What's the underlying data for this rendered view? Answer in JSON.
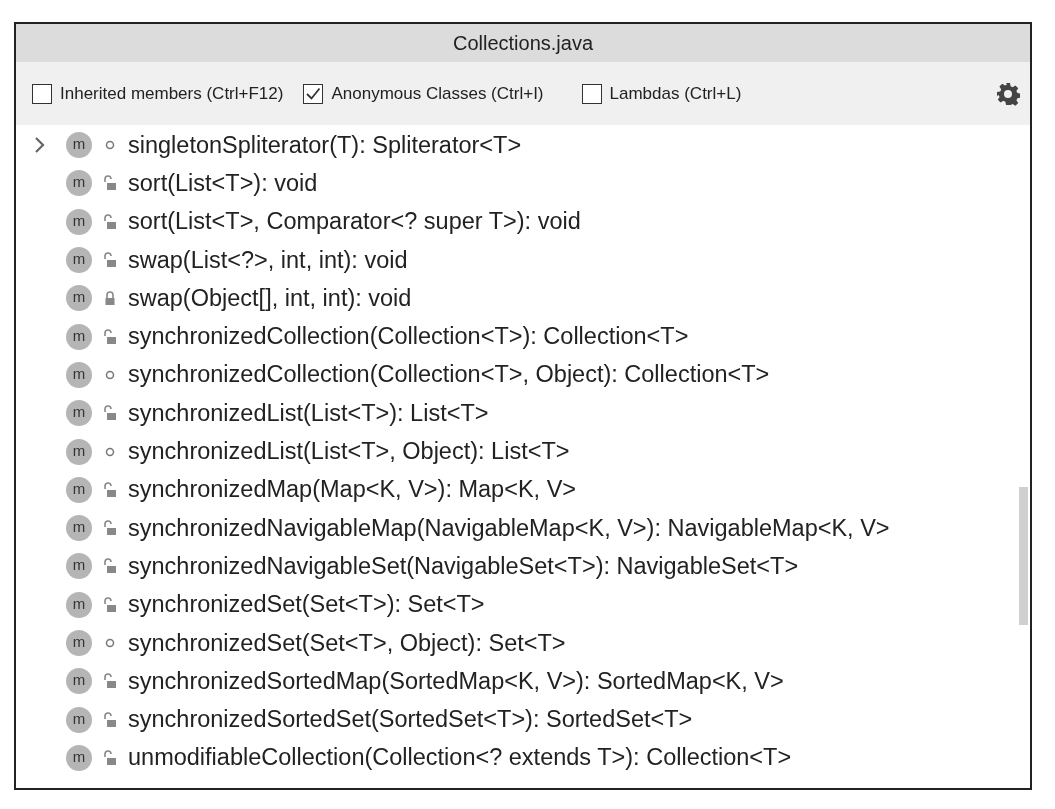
{
  "window": {
    "title": "Collections.java"
  },
  "options": [
    {
      "label": "Inherited members (Ctrl+F12)",
      "checked": false
    },
    {
      "label": "Anonymous Classes (Ctrl+I)",
      "checked": true
    },
    {
      "label": "Lambdas (Ctrl+L)",
      "checked": false
    }
  ],
  "members": [
    {
      "icon": "m",
      "kind": "package",
      "has_children": true,
      "signature": "singletonSpliterator(T): Spliterator<T>"
    },
    {
      "icon": "m",
      "kind": "public",
      "has_children": false,
      "signature": "sort(List<T>): void"
    },
    {
      "icon": "m",
      "kind": "public",
      "has_children": false,
      "signature": "sort(List<T>, Comparator<? super T>): void"
    },
    {
      "icon": "m",
      "kind": "public",
      "has_children": false,
      "signature": "swap(List<?>, int, int): void"
    },
    {
      "icon": "m",
      "kind": "private",
      "has_children": false,
      "signature": "swap(Object[], int, int): void"
    },
    {
      "icon": "m",
      "kind": "public",
      "has_children": false,
      "signature": "synchronizedCollection(Collection<T>): Collection<T>"
    },
    {
      "icon": "m",
      "kind": "package",
      "has_children": false,
      "signature": "synchronizedCollection(Collection<T>, Object): Collection<T>"
    },
    {
      "icon": "m",
      "kind": "public",
      "has_children": false,
      "signature": "synchronizedList(List<T>): List<T>"
    },
    {
      "icon": "m",
      "kind": "package",
      "has_children": false,
      "signature": "synchronizedList(List<T>, Object): List<T>"
    },
    {
      "icon": "m",
      "kind": "public",
      "has_children": false,
      "signature": "synchronizedMap(Map<K, V>): Map<K, V>"
    },
    {
      "icon": "m",
      "kind": "public",
      "has_children": false,
      "signature": "synchronizedNavigableMap(NavigableMap<K, V>): NavigableMap<K, V>"
    },
    {
      "icon": "m",
      "kind": "public",
      "has_children": false,
      "signature": "synchronizedNavigableSet(NavigableSet<T>): NavigableSet<T>"
    },
    {
      "icon": "m",
      "kind": "public",
      "has_children": false,
      "signature": "synchronizedSet(Set<T>): Set<T>"
    },
    {
      "icon": "m",
      "kind": "package",
      "has_children": false,
      "signature": "synchronizedSet(Set<T>, Object): Set<T>"
    },
    {
      "icon": "m",
      "kind": "public",
      "has_children": false,
      "signature": "synchronizedSortedMap(SortedMap<K, V>): SortedMap<K, V>"
    },
    {
      "icon": "m",
      "kind": "public",
      "has_children": false,
      "signature": "synchronizedSortedSet(SortedSet<T>): SortedSet<T>"
    },
    {
      "icon": "m",
      "kind": "public",
      "has_children": false,
      "signature": "unmodifiableCollection(Collection<? extends T>): Collection<T>"
    }
  ]
}
